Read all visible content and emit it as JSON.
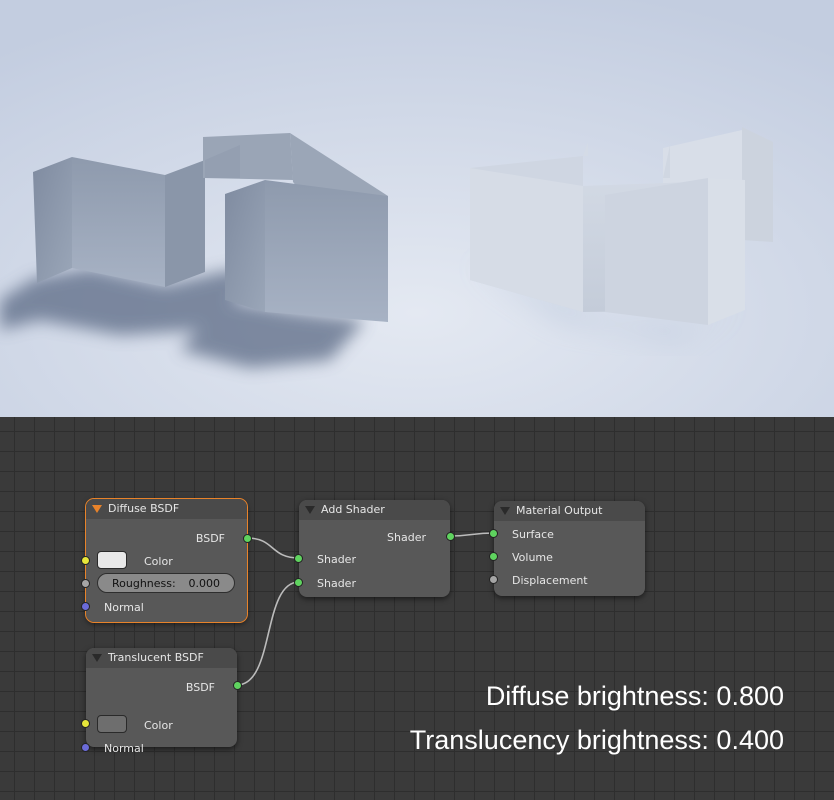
{
  "nodes": {
    "diffuse": {
      "title": "Diffuse BSDF",
      "output": "BSDF",
      "color_label": "Color",
      "color_swatch": "#e8e8e8",
      "roughness_label": "Roughness:",
      "roughness_value": "0.000",
      "normal_label": "Normal"
    },
    "translucent": {
      "title": "Translucent BSDF",
      "output": "BSDF",
      "color_label": "Color",
      "color_swatch": "#6e6e6e",
      "normal_label": "Normal"
    },
    "add_shader": {
      "title": "Add Shader",
      "output": "Shader",
      "input1": "Shader",
      "input2": "Shader"
    },
    "material_output": {
      "title": "Material Output",
      "surface": "Surface",
      "volume": "Volume",
      "displacement": "Displacement"
    }
  },
  "caption": {
    "line1": "Diffuse brightness: 0.800",
    "line2": "Translucency brightness: 0.400"
  },
  "colors": {
    "accent_active": "#e8832a",
    "socket_shader": "#5fd35f",
    "socket_color": "#e6e63a",
    "socket_float": "#a5a5a5",
    "socket_vector": "#6b6bd8"
  }
}
